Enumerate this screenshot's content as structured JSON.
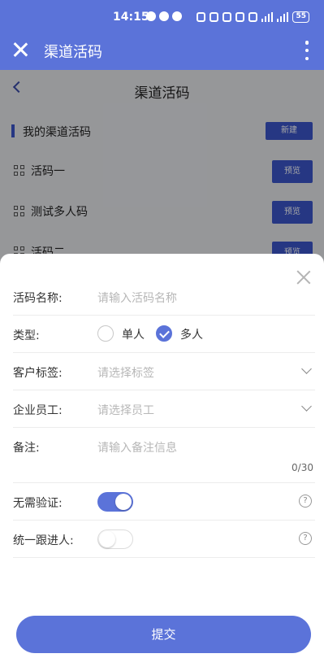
{
  "status_bar": {
    "time": "14:15",
    "network_label": "5G",
    "battery": "55"
  },
  "app_header": {
    "title": "渠道活码"
  },
  "page": {
    "nav_title": "渠道活码",
    "section_title": "我的渠道活码",
    "new_button": "新建",
    "items": [
      {
        "label": "活码一",
        "button": "预览"
      },
      {
        "label": "测试多人码",
        "button": "预览"
      },
      {
        "label": "活码二",
        "button": "预览"
      }
    ]
  },
  "form": {
    "name": {
      "label": "活码名称:",
      "placeholder": "请输入活码名称"
    },
    "type": {
      "label": "类型:",
      "options": [
        "单人",
        "多人"
      ],
      "selected": "多人"
    },
    "customer_tag": {
      "label": "客户标签:",
      "placeholder": "请选择标签"
    },
    "staff": {
      "label": "企业员工:",
      "placeholder": "请选择员工"
    },
    "remark": {
      "label": "备注:",
      "placeholder": "请输入备注信息",
      "counter": "0/30"
    },
    "no_verify": {
      "label": "无需验证:",
      "enabled": true
    },
    "unified_follow": {
      "label": "统一跟进人:",
      "enabled": false
    },
    "submit_label": "提交"
  },
  "colors": {
    "primary": "#5b73d9",
    "dark_primary": "#3b55c9"
  }
}
